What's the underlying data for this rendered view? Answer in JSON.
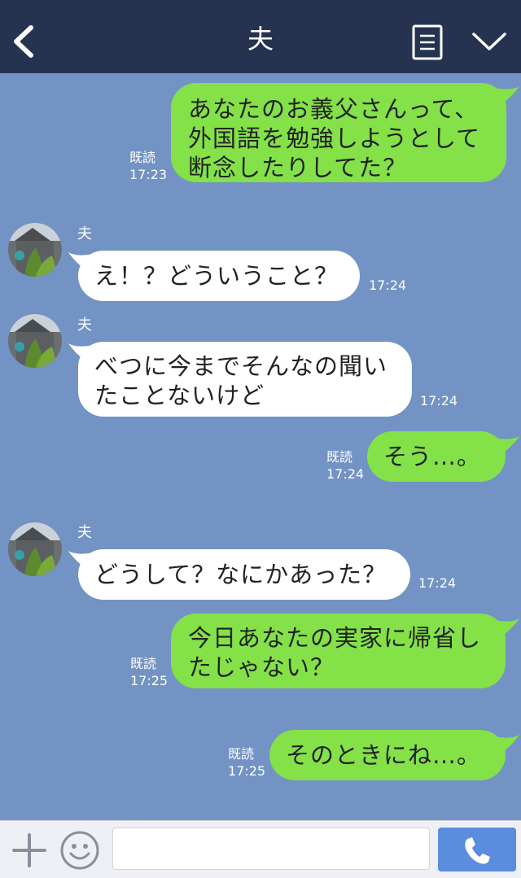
{
  "header": {
    "title": "夫",
    "back_icon": "chevron-left-icon",
    "menu_icon": "menu-list-icon",
    "collapse_icon": "chevron-down-icon"
  },
  "colors": {
    "header_bg": "#263350",
    "chat_bg": "#7393c4",
    "outgoing_bubble": "#84e148",
    "incoming_bubble": "#ffffff",
    "send_button": "#5b8cde"
  },
  "messages": [
    {
      "dir": "out",
      "text": "あなたのお義父さんって、\n外国語を勉強しようとして\n断念したりしてた？",
      "read": "既読",
      "time": "17:23"
    },
    {
      "dir": "in",
      "sender": "夫",
      "text": "え！？どういうこと？",
      "time": "17:24"
    },
    {
      "dir": "in",
      "sender": "夫",
      "text": "べつに今までそんなの聞い\nたことないけど",
      "time": "17:24"
    },
    {
      "dir": "out",
      "text": "そう…。",
      "read": "既読",
      "time": "17:24"
    },
    {
      "dir": "in",
      "sender": "夫",
      "text": "どうして？なにかあった？",
      "time": "17:24"
    },
    {
      "dir": "out",
      "text": "今日あなたの実家に帰省し\nたじゃない？",
      "read": "既読",
      "time": "17:25"
    },
    {
      "dir": "out",
      "text": "そのときにね…。",
      "read": "既読",
      "time": "17:25"
    }
  ],
  "bottom_bar": {
    "plus_icon": "plus-icon",
    "emoji_icon": "smiley-icon",
    "input_value": "",
    "call_icon": "phone-icon"
  }
}
